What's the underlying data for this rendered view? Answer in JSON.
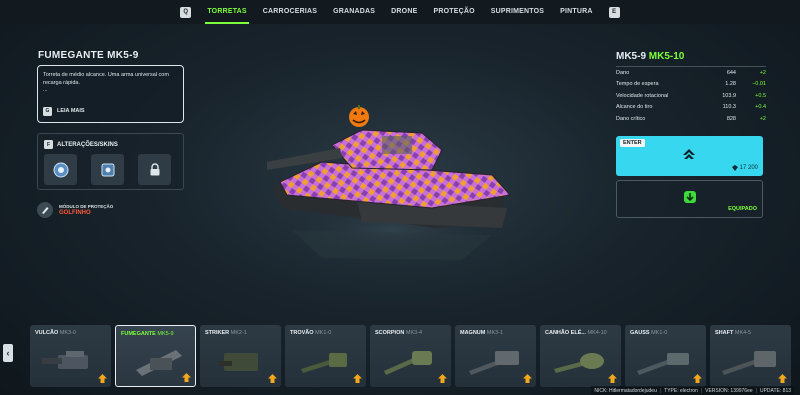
{
  "nav": {
    "key_left": "Q",
    "key_right": "E",
    "tabs": [
      {
        "label": "TORRETAS",
        "active": true
      },
      {
        "label": "CARROCERIAS"
      },
      {
        "label": "GRANADAS"
      },
      {
        "label": "DRONE"
      },
      {
        "label": "PROTEÇÃO"
      },
      {
        "label": "SUPRIMENTOS"
      },
      {
        "label": "PINTURA"
      }
    ]
  },
  "item": {
    "title": "FUMEGANTE MK5-9",
    "description": "Torreta de médio alcance. Uma arma universal com recarga rápida.",
    "ellipsis": "...",
    "more_key": "G",
    "more_label": "LEIA MAIS"
  },
  "alterations": {
    "key": "F",
    "title": "ALTERAÇÕES/SKINS",
    "slots": [
      "gear-alteration-icon",
      "target-alteration-icon",
      "lock-icon"
    ]
  },
  "module": {
    "label": "MÓDULO DE PROTEÇÃO",
    "value": "GOLFINHO"
  },
  "upgrade": {
    "current": "MK5-9",
    "next": "MK5-10",
    "stats": [
      {
        "name": "Dano",
        "value": "644",
        "delta": "+2"
      },
      {
        "name": "Tempo de espera",
        "value": "1.28",
        "delta": "−0.01"
      },
      {
        "name": "Velocidade rotacional",
        "value": "103.9",
        "delta": "+0.5"
      },
      {
        "name": "Alcance do tiro",
        "value": "110.3",
        "delta": "+0.4"
      },
      {
        "name": "Dano crítico",
        "value": "828",
        "delta": "+2"
      }
    ],
    "enter_key": "ENTER",
    "price": "17 200",
    "equipped_label": "EQUIPADO"
  },
  "carousel": [
    {
      "name": "VULCÃO",
      "mk": "MK3-0"
    },
    {
      "name": "FUMEGANTE",
      "mk": "MK5-9",
      "selected": true
    },
    {
      "name": "STRIKER",
      "mk": "MK2-1"
    },
    {
      "name": "TROVÃO",
      "mk": "MK1-0"
    },
    {
      "name": "SCORPION",
      "mk": "MK3-4"
    },
    {
      "name": "MAGNUM",
      "mk": "MK3-1"
    },
    {
      "name": "CANHÃO ELÉ...",
      "mk": "MK4-10"
    },
    {
      "name": "GAUSS",
      "mk": "MK1-0"
    },
    {
      "name": "SHAFT",
      "mk": "MK4-5"
    }
  ],
  "footer": {
    "nick": "NICK: Hitlermatadordejudeu",
    "type": "TYPE: electron",
    "version": "VERSION: 139976ee",
    "update": "UPDATE: 813"
  },
  "colors": {
    "accent": "#7cff3a",
    "upgrade_button": "#38d7f0",
    "module_value": "#ff5a3c"
  }
}
